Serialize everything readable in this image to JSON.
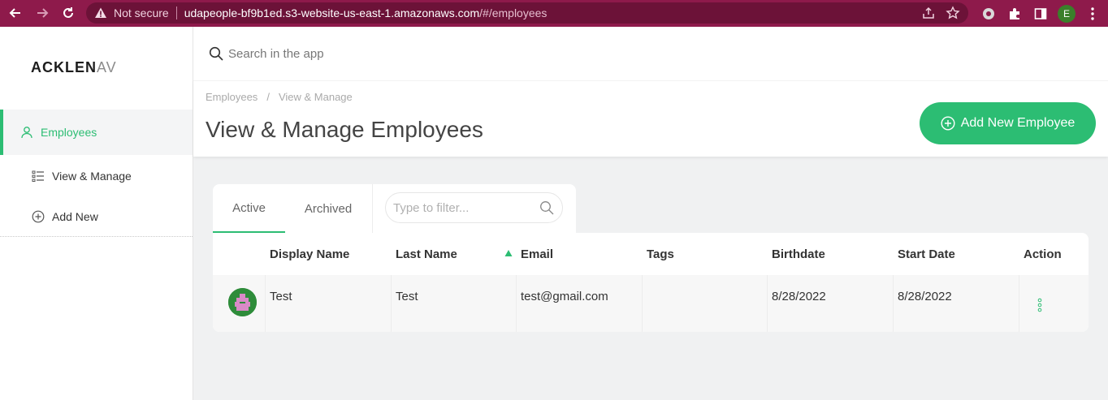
{
  "browser": {
    "security_label": "Not secure",
    "url_host": "udapeople-bf9b1ed.s3-website-us-east-1.amazonaws.com",
    "url_path": "/#/employees",
    "profile_initial": "E"
  },
  "sidebar": {
    "logo_main": "ACKLEN",
    "logo_tail": "AV",
    "items": [
      {
        "label": "Employees",
        "icon": "user-icon",
        "active": true
      },
      {
        "label": "View & Manage",
        "icon": "list-icon",
        "active": false
      },
      {
        "label": "Add New",
        "icon": "plus-circle-icon",
        "active": false
      }
    ]
  },
  "topbar": {
    "search_placeholder": "Search in the app"
  },
  "header": {
    "breadcrumb": [
      "Employees",
      "View & Manage"
    ],
    "title": "View & Manage Employees",
    "add_button_label": "Add New Employee"
  },
  "tabs": {
    "items": [
      "Active",
      "Archived"
    ],
    "active": "Active",
    "filter_placeholder": "Type to filter..."
  },
  "table": {
    "columns": [
      "Display Name",
      "Last Name",
      "Email",
      "Tags",
      "Birthdate",
      "Start Date",
      "Action"
    ],
    "sorted_column": "Email",
    "rows": [
      {
        "display_name": "Test",
        "last_name": "Test",
        "email": "test@gmail.com",
        "tags": "",
        "birthdate": "8/28/2022",
        "start_date": "8/28/2022"
      }
    ]
  },
  "colors": {
    "accent": "#2cbd73",
    "browser_frame": "#8e1a4b"
  }
}
